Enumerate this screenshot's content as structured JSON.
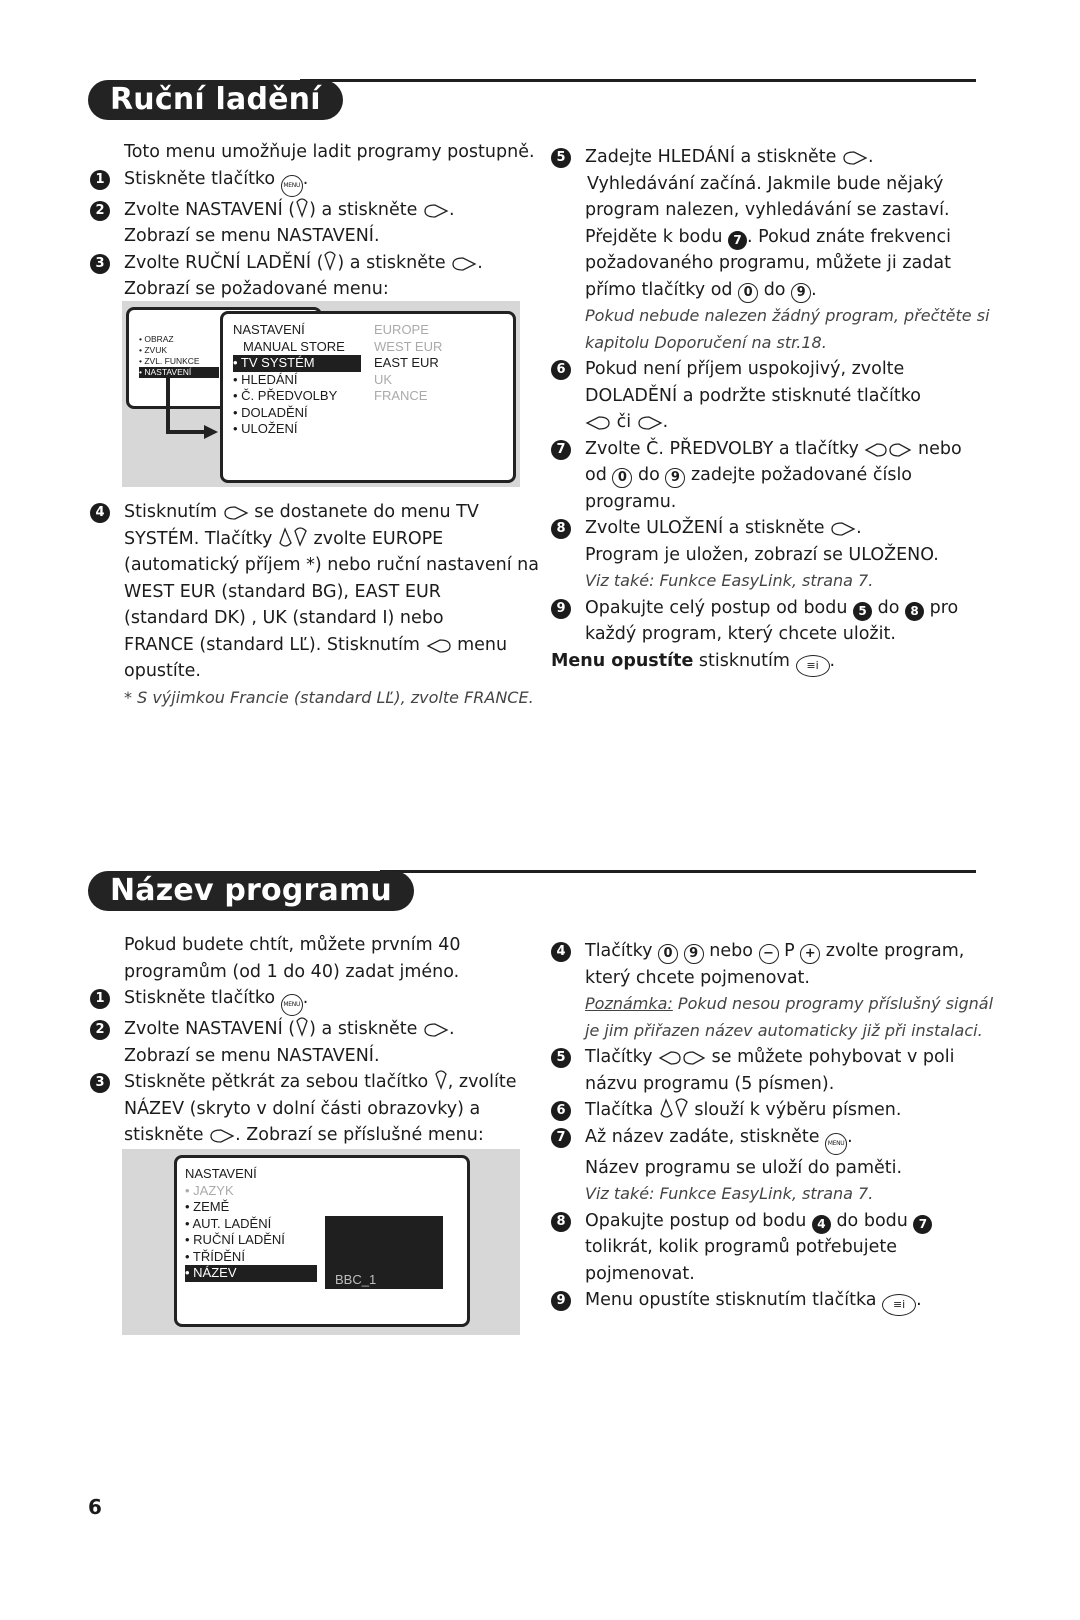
{
  "section1": {
    "title": "Ruční ladění",
    "intro": "Toto menu umožňuje ladit programy postupně.",
    "steps": {
      "s1": "Stiskněte tlačítko",
      "s2a": "Zvolte NASTAVENÍ (",
      "s2b": ") a stiskněte",
      "s2c": "Zobrazí se menu NASTAVENÍ.",
      "s3a": "Zvolte RUČNÍ LADĚNÍ (",
      "s3b": ") a stiskněte",
      "s3c": "Zobrazí se požadované menu:",
      "s4_lines": [
        "Stisknutím",
        "se dostanete do menu TV",
        "SYSTÉM. Tlačítky",
        "zvolte EUROPE",
        "(automatický příjem *) nebo ruční nastavení na",
        "WEST EUR (standard BG), EAST EUR",
        "(standard DK) , UK (standard I) nebo",
        "FRANCE (standard LĽ). Stisknutím",
        "menu",
        "opustíte."
      ],
      "s4_note": "* S výjimkou Francie (standard LĽ), zvolte FRANCE.",
      "s5a": "Zadejte HLEDÁNÍ a stiskněte",
      "s5_lines": [
        "Vyhledávání začíná. Jakmile bude nějaký",
        "program nalezen, vyhledávání se zastaví.",
        "Přejděte k bodu",
        ". Pokud znáte frekvenci",
        "požadovaného programu, můžete ji zadat",
        "přímo tlačítky od",
        "do"
      ],
      "s5_note": [
        "Pokud nebude nalezen žádný program, přečtěte si",
        "kapitolu Doporučení na str.18."
      ],
      "s6_lines": [
        "Pokud není příjem uspokojivý, zvolte",
        "DOLADĚNÍ a podržte stisknuté tlačítko",
        "či"
      ],
      "s7_lines": [
        "Zvolte Č. PŘEDVOLBY a tlačítky",
        "nebo",
        "od",
        "do",
        "zadejte požadované číslo",
        "programu."
      ],
      "s8_lines": [
        "Zvolte ULOŽENÍ a stiskněte",
        "Program je uložen, zobrazí se ULOŽENO."
      ],
      "s8_note": "Viz také: Funkce EasyLink, strana 7.",
      "s9_lines": [
        "Opakujte celý postup od bodu",
        "do",
        "pro",
        "každý program, který chcete uložit."
      ],
      "exit_bold": "Menu opustíte",
      "exit_rest": "stisknutím"
    },
    "screen": {
      "main_menu": [
        "• OBRAZ",
        "• ZVUK",
        "• ZVL. FUNKCE",
        "• NASTAVENÍ"
      ],
      "sub_title": "NASTAVENÍ",
      "sub_items": [
        "MANUAL STORE",
        "• TV SYSTÉM",
        "• HLEDÁNÍ",
        "• Č. PŘEDVOLBY",
        "• DOLADĚNÍ",
        "• ULOŽENÍ"
      ],
      "options": [
        "EUROPE",
        "WEST EUR",
        "EAST EUR",
        "UK",
        "FRANCE"
      ],
      "selected_option": "EAST EUR"
    }
  },
  "section2": {
    "title": "Název programu",
    "intro": [
      "Pokud budete chtít, můžete prvním 40",
      "programům (od 1 do 40) zadat jméno."
    ],
    "s1": "Stiskněte tlačítko",
    "s2a": "Zvolte NASTAVENÍ (",
    "s2b": ") a stiskněte",
    "s2c": "Zobrazí se menu NASTAVENÍ.",
    "s3_lines": [
      "Stiskněte pětkrát za sebou tlačítko",
      ", zvolíte",
      "NÁZEV (skryto v dolní části obrazovky) a",
      "stiskněte",
      ". Zobrazí se příslušné menu:"
    ],
    "s4_lines": [
      "Tlačítky",
      "nebo",
      "P",
      "zvolte program,",
      "který chcete pojmenovat."
    ],
    "s4_note_label": "Poznámka:",
    "s4_note": [
      "Pokud nesou programy příslušný signál",
      "je jim přiřazen název automaticky již při instalaci."
    ],
    "s5_lines": [
      "Tlačítky",
      "se můžete pohybovat v poli",
      "názvu programu (5 písmen)."
    ],
    "s6_lines": [
      "Tlačítka",
      "slouží k výběru písmen."
    ],
    "s7_lines": [
      "Až název zadáte, stiskněte",
      "Název programu se uloží do paměti."
    ],
    "s7_note": "Viz také: Funkce EasyLink, strana 7.",
    "s8_lines": [
      "Opakujte postup od bodu",
      "do bodu",
      "tolikrát, kolik programů potřebujete",
      "pojmenovat."
    ],
    "s9": "Menu opustíte stisknutím tlačítka",
    "screen": {
      "title": "NASTAVENÍ",
      "items": [
        "• JAZYK",
        "• ZEMĚ",
        "• AUT. LADĚNÍ",
        "• RUČNÍ LADĚNÍ",
        "• TŘÍDĚNÍ",
        "• NÁZEV"
      ],
      "preview_label": "BBC_1"
    }
  },
  "icons": {
    "menu_key": "MENU",
    "info_key": "≡i",
    "zero": "0",
    "nine": "9",
    "minus": "−",
    "plus": "+"
  },
  "step_numbers": [
    "1",
    "2",
    "3",
    "4",
    "5",
    "6",
    "7",
    "8",
    "9"
  ],
  "page_number": "6"
}
